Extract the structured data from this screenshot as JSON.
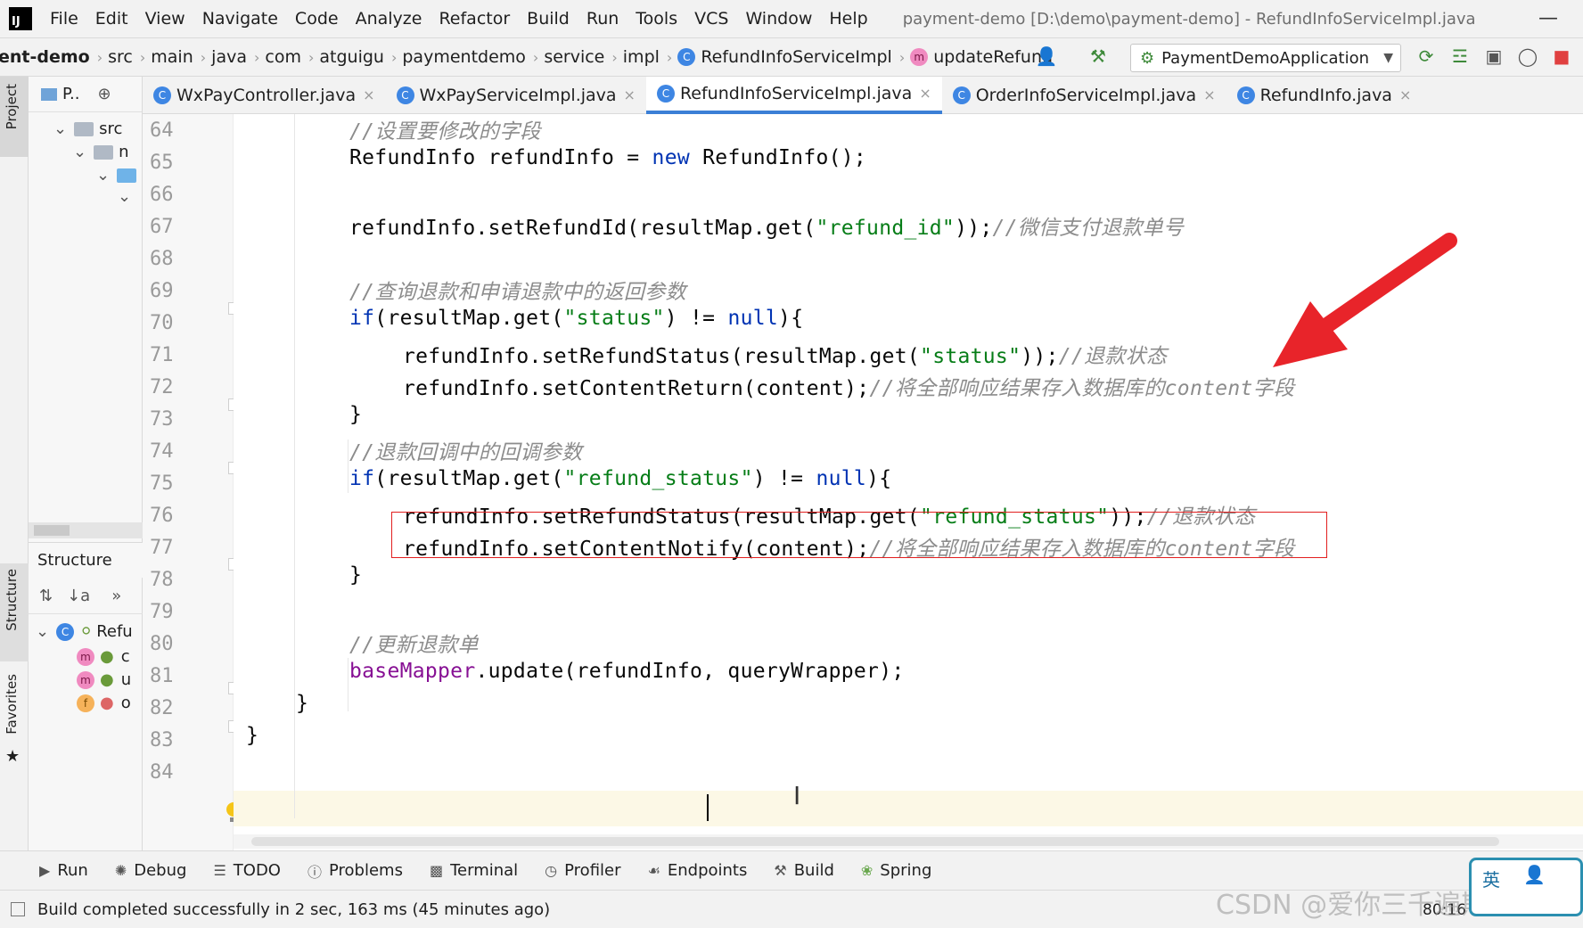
{
  "menubar": {
    "items": [
      "File",
      "Edit",
      "View",
      "Navigate",
      "Code",
      "Analyze",
      "Refactor",
      "Build",
      "Run",
      "Tools",
      "VCS",
      "Window",
      "Help"
    ],
    "window_title": "payment-demo [D:\\demo\\payment-demo] - RefundInfoServiceImpl.java"
  },
  "breadcrumb": {
    "items": [
      "ent-demo",
      "src",
      "main",
      "java",
      "com",
      "atguigu",
      "paymentdemo",
      "service",
      "impl"
    ],
    "class_name": "RefundInfoServiceImpl",
    "method_name": "updateRefund"
  },
  "run_config": {
    "label": "PaymentDemoApplication"
  },
  "project_panel": {
    "title": "P..",
    "tree": [
      "src",
      "n",
      "",
      ""
    ]
  },
  "structure_panel": {
    "title": "Structure",
    "items": [
      "Refu",
      "c",
      "u",
      "o"
    ]
  },
  "side_labels": {
    "project": "Project",
    "structure": "Structure",
    "favorites": "Favorites"
  },
  "tabs": [
    {
      "label": "WxPayController.java",
      "active": false
    },
    {
      "label": "WxPayServiceImpl.java",
      "active": false
    },
    {
      "label": "RefundInfoServiceImpl.java",
      "active": true
    },
    {
      "label": "OrderInfoServiceImpl.java",
      "active": false
    },
    {
      "label": "RefundInfo.java",
      "active": false
    }
  ],
  "gutter": {
    "line_numbers": [
      "64",
      "65",
      "66",
      "67",
      "68",
      "69",
      "70",
      "71",
      "72",
      "73",
      "74",
      "75",
      "76",
      "77",
      "78",
      "79",
      "80",
      "81",
      "82",
      "83",
      "84"
    ]
  },
  "code": {
    "l64_cmt": "//设置要修改的字段",
    "l65_a": "RefundInfo refundInfo = ",
    "l65_kw": "new",
    "l65_b": " RefundInfo();",
    "l67_a": "refundInfo.setRefundId(resultMap.get(",
    "l67_str": "\"refund_id\"",
    "l67_b": "));",
    "l67_cmt": "//微信支付退款单号",
    "l69_cmt": "//查询退款和申请退款中的返回参数",
    "l70_kw": "if",
    "l70_a": "(resultMap.get(",
    "l70_str": "\"status\"",
    "l70_b": ") != ",
    "l70_kw2": "null",
    "l70_c": "){",
    "l71_a": "refundInfo.setRefundStatus(resultMap.get(",
    "l71_str": "\"status\"",
    "l71_b": "));",
    "l71_cmt": "//退款状态",
    "l72_a": "refundInfo.setContentReturn(content);",
    "l72_cmt": "//将全部响应结果存入数据库的content字段",
    "l73": "}",
    "l74_cmt": "//退款回调中的回调参数",
    "l75_kw": "if",
    "l75_a": "(resultMap.get(",
    "l75_str": "\"refund_status\"",
    "l75_b": ") != ",
    "l75_kw2": "null",
    "l75_c": "){",
    "l76_a": "refundInfo.setRefundStatus(resultMap.get(",
    "l76_str": "\"refund_status\"",
    "l76_b": "));",
    "l76_cmt": "//退款状态",
    "l77_a": "refundInfo.setContentNotify(content);",
    "l77_cmt": "//将全部响应结果存入数据库的content字段",
    "l78": "}",
    "l80_cmt": "//更新退款单",
    "l81_fld": "baseMapper",
    "l81_a": ".update(refundInfo, queryWrapper);",
    "l82": "}",
    "l83": "}"
  },
  "bottom_tools": [
    "Run",
    "Debug",
    "TODO",
    "Problems",
    "Terminal",
    "Profiler",
    "Endpoints",
    "Build",
    "Spring"
  ],
  "status": {
    "message": "Build completed successfully in 2 sec, 163 ms (45 minutes ago)",
    "position": "80:16"
  },
  "watermark": "CSDN @爱你三千遍斯塔克",
  "ime": {
    "label": "英"
  },
  "colors": {
    "keyword": "#0033b3",
    "string": "#067d17",
    "comment": "#8c8c8c",
    "field": "#871094",
    "highlight_box": "#e21f1f",
    "arrow": "#e8242a",
    "active_tab": "#3b7fd6"
  }
}
